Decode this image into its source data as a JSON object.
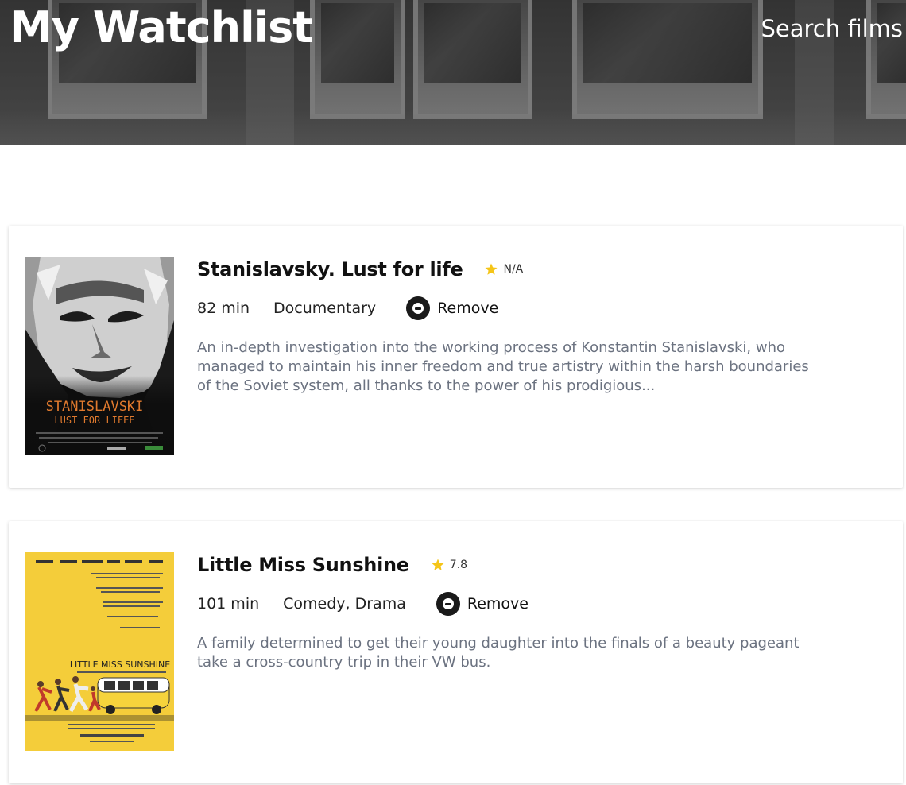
{
  "header": {
    "title": "My Watchlist",
    "search_link": "Search films"
  },
  "colors": {
    "star": "#f5c518",
    "description_text": "#6b7280",
    "remove_icon": "#1a1a1a"
  },
  "watchlist": [
    {
      "title": "Stanislavsky. Lust for life",
      "rating": "N/A",
      "runtime": "82 min",
      "genre": "Documentary",
      "remove_label": "Remove",
      "description": "An in-depth investigation into the working process of Konstantin Stanislavski, who managed to maintain his inner freedom and true artistry within the harsh boundaries of the Soviet system, all thanks to the power of his prodigious...",
      "poster": {
        "title_line1": "STANISLAVSKI",
        "title_line2": "LUST FOR LIFEE"
      }
    },
    {
      "title": "Little Miss Sunshine",
      "rating": "7.8",
      "runtime": "101 min",
      "genre": "Comedy, Drama",
      "remove_label": "Remove",
      "description": "A family determined to get their young daughter into the finals of a beauty pageant take a cross-country trip in their VW bus.",
      "poster": {
        "title_text": "LITTLE MISS SUNSHINE"
      }
    }
  ]
}
